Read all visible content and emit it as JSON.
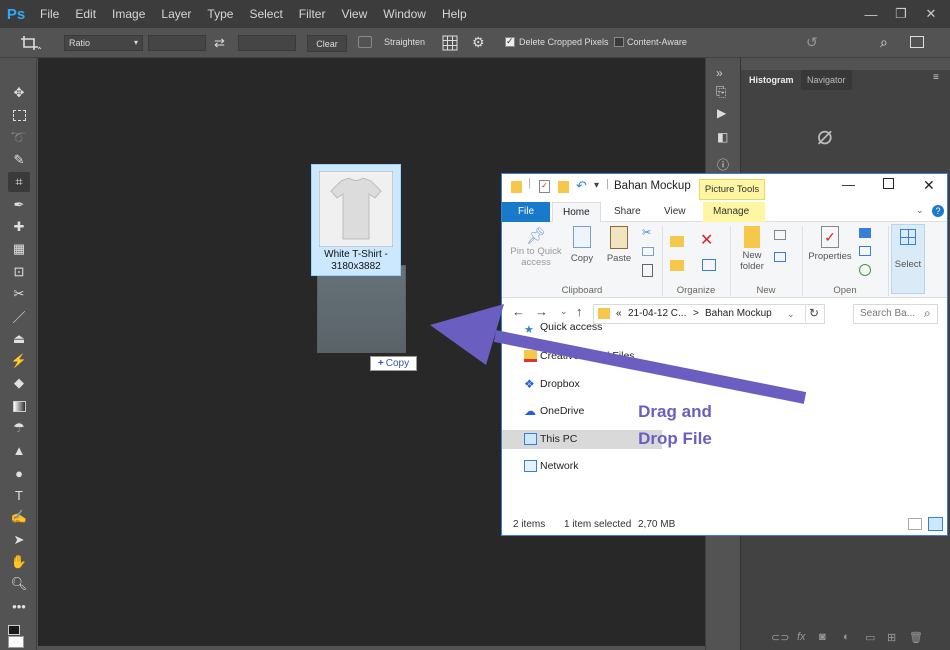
{
  "photoshop": {
    "logo": "Ps",
    "menu": [
      "File",
      "Edit",
      "Image",
      "Layer",
      "Type",
      "Select",
      "Filter",
      "View",
      "Window",
      "Help"
    ],
    "options": {
      "ratio_label": "Ratio",
      "clear_label": "Clear",
      "straighten_label": "Straighten",
      "delete_cropped_label": "Delete Cropped Pixels",
      "delete_cropped_checked": true,
      "content_aware_label": "Content-Aware",
      "content_aware_checked": false
    },
    "panels": {
      "tabs": [
        "Histogram",
        "Navigator"
      ],
      "active_tab": "Histogram"
    },
    "drag_badge": {
      "icon": "+",
      "label": "Copy"
    }
  },
  "explorer": {
    "title": "Bahan Mockup",
    "context_tab": "Picture Tools",
    "tabs": [
      "File",
      "Home",
      "Share",
      "View",
      "Manage"
    ],
    "ribbon": {
      "pin_label": "Pin to Quick access",
      "copy_label": "Copy",
      "paste_label": "Paste",
      "clipboard_group": "Clipboard",
      "organize_group": "Organize",
      "new_folder_label": "New folder",
      "new_group": "New",
      "properties_label": "Properties",
      "open_group": "Open",
      "select_label": "Select"
    },
    "address": {
      "path_prefix": "«",
      "path_part1": "21-04-12 C...",
      "path_sep": ">",
      "path_part2": "Bahan Mockup",
      "search_placeholder": "Search Ba..."
    },
    "nav": [
      "Quick access",
      "Creative Cloud Files",
      "Dropbox",
      "OneDrive",
      "This PC",
      "Network"
    ],
    "file": {
      "name_line1": "White T-Shirt -",
      "name_line2": "3180x3882"
    },
    "status": {
      "items": "2 items",
      "selected": "1 item selected",
      "size": "2,70 MB"
    }
  },
  "annotation": {
    "line1": "Drag and",
    "line2": "Drop File",
    "color": "#6a5fc1"
  }
}
